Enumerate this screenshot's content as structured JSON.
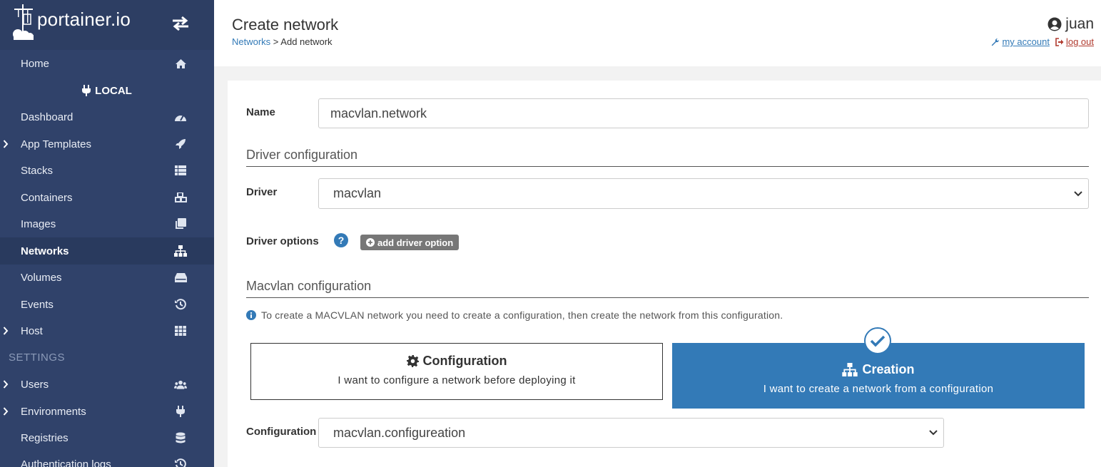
{
  "brand": {
    "name": "portainer.io"
  },
  "sidebar": {
    "items": [
      {
        "label": "Home",
        "icon": "home-icon"
      },
      {
        "label": "LOCAL",
        "icon": "plug-icon"
      },
      {
        "label": "Dashboard",
        "icon": "tachometer-icon"
      },
      {
        "label": "App Templates",
        "icon": "rocket-icon"
      },
      {
        "label": "Stacks",
        "icon": "th-list-icon"
      },
      {
        "label": "Containers",
        "icon": "cubes-icon"
      },
      {
        "label": "Images",
        "icon": "clone-icon"
      },
      {
        "label": "Networks",
        "icon": "sitemap-icon"
      },
      {
        "label": "Volumes",
        "icon": "hdd-icon"
      },
      {
        "label": "Events",
        "icon": "history-icon"
      },
      {
        "label": "Host",
        "icon": "th-icon"
      },
      {
        "label": "SETTINGS"
      },
      {
        "label": "Users",
        "icon": "users-icon"
      },
      {
        "label": "Environments",
        "icon": "plug-icon"
      },
      {
        "label": "Registries",
        "icon": "database-icon"
      },
      {
        "label": "Authentication logs",
        "icon": "history-icon"
      }
    ]
  },
  "header": {
    "title": "Create network",
    "breadcrumb": {
      "link": "Networks",
      "sep": " > ",
      "current": "Add network"
    },
    "user": "juan",
    "my_account": "my account",
    "log_out": "log out"
  },
  "form": {
    "name_label": "Name",
    "name_value": "macvlan.network",
    "driver_section": "Driver configuration",
    "driver_label": "Driver",
    "driver_value": "macvlan",
    "driver_options_label": "Driver options",
    "add_driver_option": "add driver option",
    "macvlan_section": "Macvlan configuration",
    "info_text": "To create a MACVLAN network you need to create a configuration, then create the network from this configuration.",
    "option_configuration": {
      "title": "Configuration",
      "subtitle": "I want to configure a network before deploying it"
    },
    "option_creation": {
      "title": "Creation",
      "subtitle": "I want to create a network from a configuration"
    },
    "configuration_label": "Configuration",
    "configuration_value": "macvlan.configureation"
  },
  "colors": {
    "sidebar": "#30426a",
    "accent": "#337ab7",
    "logout": "#b03a2e"
  }
}
